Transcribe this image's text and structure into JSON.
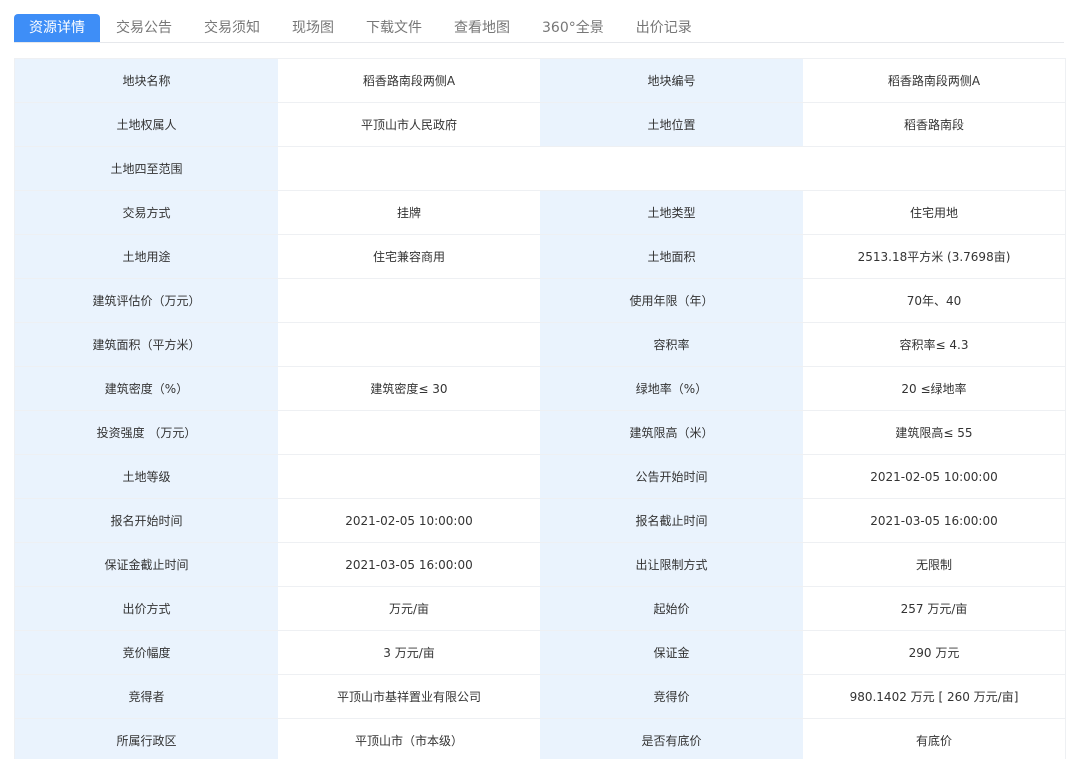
{
  "tabs": [
    {
      "label": "资源详情",
      "active": true
    },
    {
      "label": "交易公告",
      "active": false
    },
    {
      "label": "交易须知",
      "active": false
    },
    {
      "label": "现场图",
      "active": false
    },
    {
      "label": "下载文件",
      "active": false
    },
    {
      "label": "查看地图",
      "active": false
    },
    {
      "label": "360°全景",
      "active": false
    },
    {
      "label": "出价记录",
      "active": false
    }
  ],
  "colors": {
    "accent": "#3e8ef7",
    "label_bg": "#eaf3fd",
    "border": "#eef0f3",
    "tab_text": "#777777"
  },
  "rows": [
    [
      "地块名称",
      "稻香路南段两侧A",
      "地块编号",
      "稻香路南段两侧A"
    ],
    [
      "土地权属人",
      "平顶山市人民政府",
      "土地位置",
      "稻香路南段"
    ],
    [
      "土地四至范围",
      ""
    ],
    [
      "交易方式",
      "挂牌",
      "土地类型",
      "住宅用地"
    ],
    [
      "土地用途",
      "住宅兼容商用",
      "土地面积",
      "2513.18平方米 (3.7698亩)"
    ],
    [
      "建筑评估价（万元）",
      "",
      "使用年限（年）",
      "70年、40"
    ],
    [
      "建筑面积（平方米）",
      "",
      "容积率",
      "容积率≤ 4.3"
    ],
    [
      "建筑密度（%）",
      "建筑密度≤ 30",
      "绿地率（%）",
      "20 ≤绿地率"
    ],
    [
      "投资强度 （万元）",
      "",
      "建筑限高（米）",
      "建筑限高≤ 55"
    ],
    [
      "土地等级",
      "",
      "公告开始时间",
      "2021-02-05 10:00:00"
    ],
    [
      "报名开始时间",
      "2021-02-05 10:00:00",
      "报名截止时间",
      "2021-03-05 16:00:00"
    ],
    [
      "保证金截止时间",
      "2021-03-05 16:00:00",
      "出让限制方式",
      "无限制"
    ],
    [
      "出价方式",
      "万元/亩",
      "起始价",
      "257 万元/亩"
    ],
    [
      "竞价幅度",
      "3 万元/亩",
      "保证金",
      "290 万元"
    ],
    [
      "竞得者",
      "平顶山市基祥置业有限公司",
      "竞得价",
      "980.1402 万元 [ 260 万元/亩]"
    ],
    [
      "所属行政区",
      "平顶山市（市本级）",
      "是否有底价",
      "有底价"
    ]
  ]
}
